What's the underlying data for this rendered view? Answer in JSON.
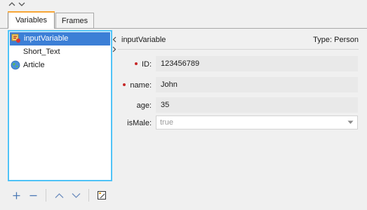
{
  "tabs": [
    {
      "label": "Variables",
      "active": true
    },
    {
      "label": "Frames",
      "active": false
    }
  ],
  "variables": [
    {
      "label": "inputVariable",
      "icon": "input-variable-icon",
      "selected": true
    },
    {
      "label": "Short_Text",
      "icon": "none",
      "selected": false
    },
    {
      "label": "Article",
      "icon": "globe-icon",
      "selected": false
    }
  ],
  "detail": {
    "title": "inputVariable",
    "type_label": "Type: Person"
  },
  "fields": [
    {
      "label": "ID:",
      "value": "123456789",
      "required": true
    },
    {
      "label": "name:",
      "value": "John",
      "required": true
    },
    {
      "label": "age:",
      "value": "35",
      "required": false
    },
    {
      "label": "isMale:",
      "value": "true",
      "required": false
    }
  ],
  "toolbar": {
    "icons": [
      "plus-icon",
      "minus-icon",
      "move-up-icon",
      "move-down-icon",
      "edit-icon"
    ]
  },
  "colors": {
    "selection": "#3c7fd6",
    "list_border": "#4fc3f7",
    "active_tab_accent": "#f7a636",
    "required_dot": "#c62828"
  }
}
